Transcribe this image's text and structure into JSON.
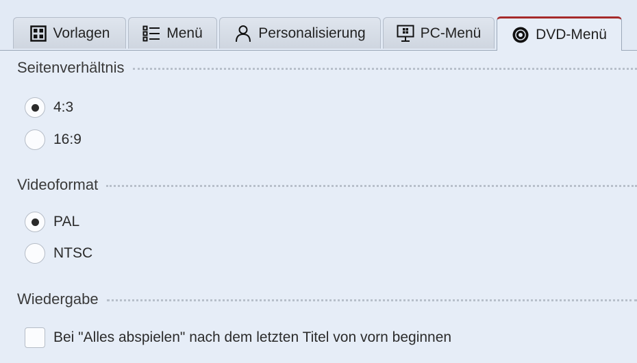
{
  "tabs": [
    {
      "label": "Vorlagen",
      "icon": "grid-icon",
      "active": false
    },
    {
      "label": "Menü",
      "icon": "list-icon",
      "active": false
    },
    {
      "label": "Personalisierung",
      "icon": "person-icon",
      "active": false
    },
    {
      "label": "PC-Menü",
      "icon": "monitor-windows-icon",
      "active": false
    },
    {
      "label": "DVD-Menü",
      "icon": "disc-icon",
      "active": true
    }
  ],
  "aspect": {
    "title": "Seitenverhältnis",
    "options": [
      {
        "label": "4:3",
        "checked": true
      },
      {
        "label": "16:9",
        "checked": false
      }
    ]
  },
  "videoformat": {
    "title": "Videoformat",
    "options": [
      {
        "label": "PAL",
        "checked": true
      },
      {
        "label": "NTSC",
        "checked": false
      }
    ]
  },
  "playback": {
    "title": "Wiedergabe",
    "checkbox": {
      "label": "Bei \"Alles abspielen\" nach dem letzten Titel von vorn beginnen",
      "checked": false
    }
  },
  "colors": {
    "active_tab_accent": "#a52a2a",
    "background": "#e6edf7"
  }
}
